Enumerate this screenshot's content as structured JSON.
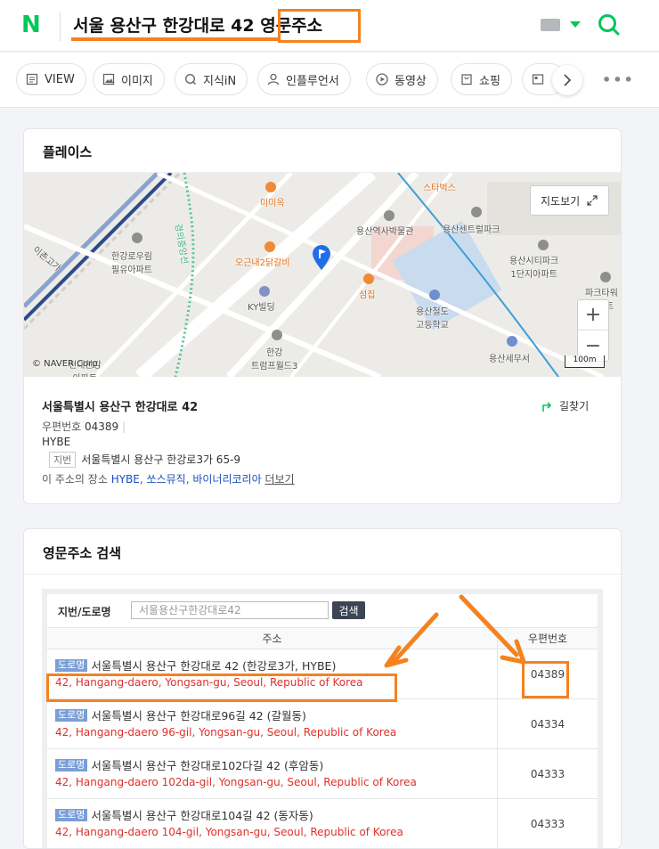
{
  "header": {
    "logo": "N",
    "query": "서울 용산구 한강대로 42 영문주소"
  },
  "tabs": [
    {
      "label": "VIEW"
    },
    {
      "label": "이미지"
    },
    {
      "label": "지식iN"
    },
    {
      "label": "인플루언서"
    },
    {
      "label": "동영상"
    },
    {
      "label": "쇼핑"
    }
  ],
  "place": {
    "title": "플레이스",
    "map": {
      "view_button": "지도보기",
      "zoom_in": "+",
      "zoom_out": "−",
      "copyright": "© NAVER Corp.",
      "scale": "100m",
      "labels": {
        "starbucks": "스타벅스",
        "mimiok": "미미옥",
        "yongsan_museum": "용산역사박물관",
        "yongsan_central": "용산센트럴파크",
        "hangangro_apt": "한강로우림\n필유아파트",
        "ogeunne": "오근내2닭갈비",
        "ky": "KY빌딩",
        "seomjip": "섬집",
        "railway_school": "용산철도\n고등학교",
        "citypark": "용산시티파크\n1단지아파트",
        "parktower": "파크타워\n아파트",
        "trump": "한강\n트럼프월드3",
        "hyundai": "현대한강\n아파트",
        "tax_office": "용산세무서",
        "ichon": "이촌고가",
        "gyeongui": "경의중앙선"
      }
    },
    "address_main": "서울특별시 용산구 한강대로 42",
    "route_label": "길찾기",
    "postal_label": "우편번호",
    "postal_code": "04389",
    "building": "HYBE",
    "jibun_tag": "지번",
    "jibun_address": "서울특별시 용산구 한강로3가 65-9",
    "places_prefix": "이 주소의 장소",
    "places": [
      "HYBE",
      "쏘스뮤직",
      "바이너리코리아"
    ],
    "more_label": "더보기"
  },
  "english_search": {
    "title": "영문주소 검색",
    "search_label": "지번/도로명",
    "search_placeholder": "서울용산구한강대로42",
    "search_button": "검색",
    "col_address": "주소",
    "col_zip": "우편번호",
    "rows": [
      {
        "tag": "도로명",
        "korean": "서울특별시 용산구 한강대로 42 (한강로3가, HYBE)",
        "english": "42, Hangang-daero, Yongsan-gu, Seoul, Republic of Korea",
        "zip": "04389"
      },
      {
        "tag": "도로명",
        "korean": "서울특별시 용산구 한강대로96길 42 (갈월동)",
        "english": "42, Hangang-daero 96-gil, Yongsan-gu, Seoul, Republic of Korea",
        "zip": "04334"
      },
      {
        "tag": "도로명",
        "korean": "서울특별시 용산구 한강대로102다길 42 (후암동)",
        "english": "42, Hangang-daero 102da-gil, Yongsan-gu, Seoul, Republic of Korea",
        "zip": "04333"
      },
      {
        "tag": "도로명",
        "korean": "서울특별시 용산구 한강대로104길 42 (동자동)",
        "english": "42, Hangang-daero 104-gil, Yongsan-gu, Seoul, Republic of Korea",
        "zip": "04333"
      }
    ]
  },
  "colors": {
    "brand": "#03c75a",
    "annotation": "#f5821f",
    "english_text": "#e1302a",
    "road_tag": "#7a9ed8"
  }
}
